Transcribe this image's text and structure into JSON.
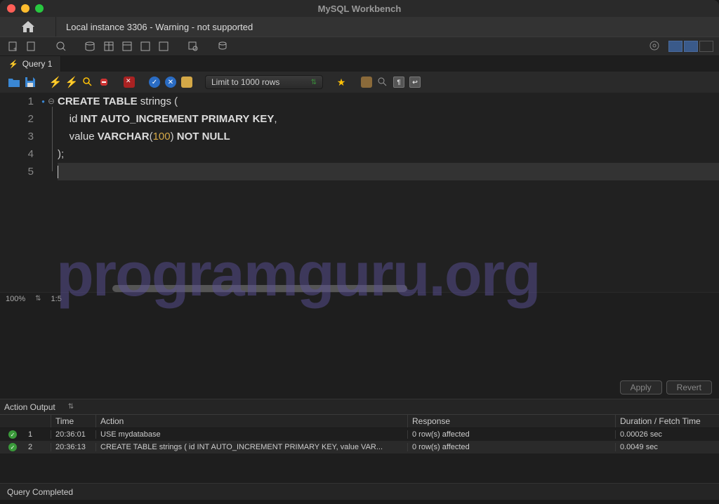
{
  "window": {
    "title": "MySQL Workbench"
  },
  "connection": {
    "tab_label": "Local instance 3306 - Warning - not supported"
  },
  "query_tab": {
    "label": "Query 1"
  },
  "editor_toolbar": {
    "limit_label": "Limit to 1000 rows"
  },
  "code": {
    "line1": {
      "kw1": "CREATE",
      "kw2": "TABLE",
      "ident": "strings",
      "rest": " ("
    },
    "line2": {
      "indent": "    ",
      "ident": "id",
      "sp": " ",
      "kw1": "INT",
      "kw2": "AUTO_INCREMENT",
      "kw3": "PRIMARY",
      "kw4": "KEY",
      "rest": ","
    },
    "line3": {
      "indent": "    ",
      "ident": "value",
      "sp": " ",
      "kw1": "VARCHAR",
      "paren": "(",
      "num": "100",
      "paren2": ")",
      "kw2": "NOT",
      "kw3": "NULL"
    },
    "line4": {
      "text": ");"
    },
    "gutter": {
      "l1": "1",
      "l2": "2",
      "l3": "3",
      "l4": "4",
      "l5": "5"
    }
  },
  "editor_status": {
    "zoom": "100%",
    "pos": "1:5"
  },
  "buttons": {
    "apply": "Apply",
    "revert": "Revert"
  },
  "output_selector": {
    "label": "Action Output"
  },
  "output_headers": {
    "time": "Time",
    "action": "Action",
    "response": "Response",
    "duration": "Duration / Fetch Time"
  },
  "output_rows": [
    {
      "num": "1",
      "time": "20:36:01",
      "action": "USE mydatabase",
      "response": "0 row(s) affected",
      "duration": "0.00026 sec"
    },
    {
      "num": "2",
      "time": "20:36:13",
      "action": "CREATE TABLE strings (     id INT AUTO_INCREMENT PRIMARY KEY,     value VAR...",
      "response": "0 row(s) affected",
      "duration": "0.0049 sec"
    }
  ],
  "statusbar": {
    "text": "Query Completed"
  },
  "watermark": "programguru.org"
}
